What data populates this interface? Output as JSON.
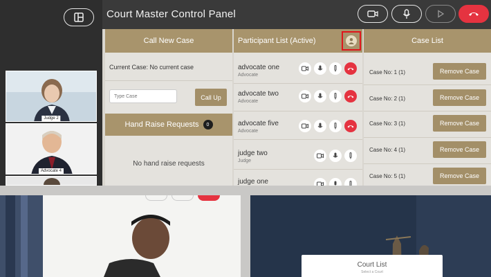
{
  "header": {
    "title": "Court Master Control Panel"
  },
  "sidebar": {
    "thumbnails": [
      {
        "label": "Judge 2"
      },
      {
        "label": "Advocate 4"
      }
    ]
  },
  "call_new_case": {
    "heading": "Call New Case",
    "current_case": "Current Case: No current case",
    "input_placeholder": "Type Case",
    "call_up_label": "Call Up"
  },
  "hand_raise": {
    "heading": "Hand Raise Requests",
    "count": "0",
    "empty_text": "No hand raise requests"
  },
  "participants": {
    "heading": "Participant List (Active)",
    "items": [
      {
        "name": "advocate one",
        "role": "Advocate"
      },
      {
        "name": "advocate two",
        "role": "Advocate"
      },
      {
        "name": "advocate five",
        "role": "Advocate"
      },
      {
        "name": "judge two",
        "role": "Judge"
      },
      {
        "name": "judge one",
        "role": ""
      }
    ]
  },
  "case_list": {
    "heading": "Case List",
    "remove_label": "Remove Case",
    "items": [
      {
        "case": "Case No: 1 (1)"
      },
      {
        "case": "Case No: 2 (1)"
      },
      {
        "case": "Case No: 3 (1)"
      },
      {
        "case": "Case No: 4 (1)"
      },
      {
        "case": "Case No: 5 (1)"
      }
    ]
  },
  "court_list": {
    "title": "Court List",
    "subtitle": "Select a Court"
  },
  "colors": {
    "accent": "#a8946c",
    "danger": "#e53340",
    "header": "#3a3a3a"
  }
}
